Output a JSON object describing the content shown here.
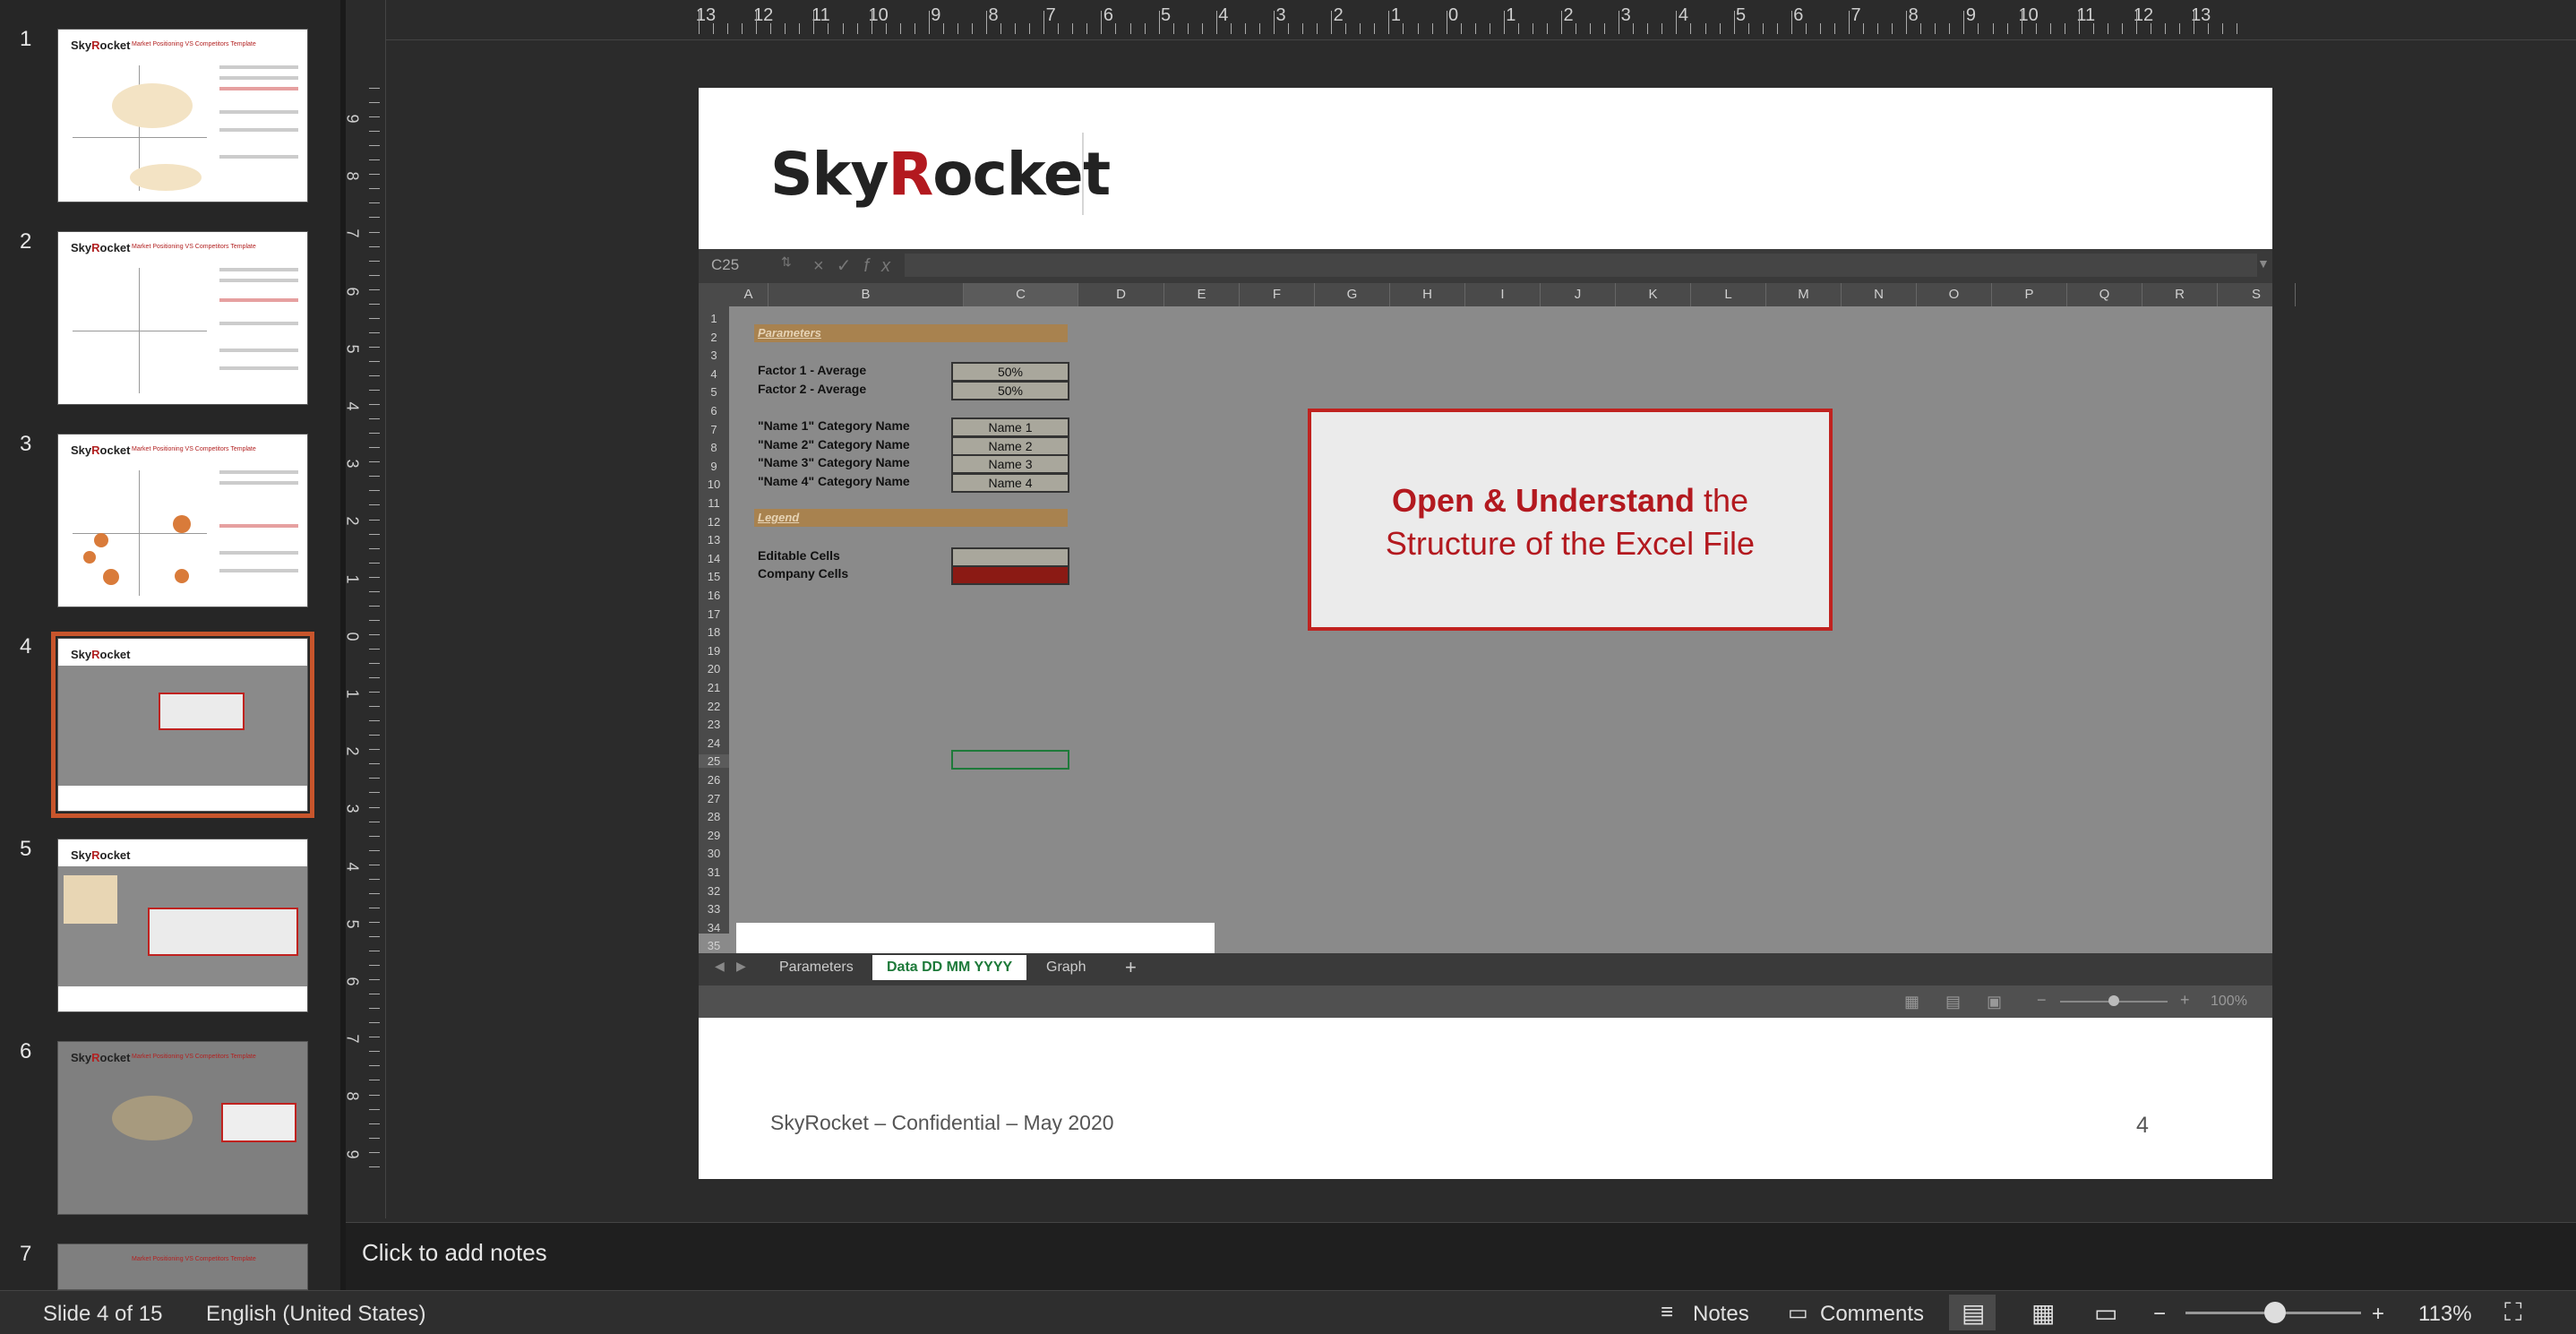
{
  "thumbnails": [
    {
      "number": "1",
      "title": "Market Positioning VS Competitors Template"
    },
    {
      "number": "2",
      "title": "Market Positioning VS Competitors Template"
    },
    {
      "number": "3",
      "title": "Market Positioning VS Competitors Template"
    },
    {
      "number": "4",
      "title": ""
    },
    {
      "number": "5",
      "title": ""
    },
    {
      "number": "6",
      "title": "Market Positioning VS Competitors Template"
    },
    {
      "number": "7",
      "title": "Market Positioning VS Competitors Template"
    }
  ],
  "thumb_logo": "Sky",
  "thumb_logo_r": "R",
  "thumb_logo_end": "ocket",
  "ruler": {
    "h": [
      "13",
      "12",
      "11",
      "10",
      "9",
      "8",
      "7",
      "6",
      "5",
      "4",
      "3",
      "2",
      "1",
      "0",
      "1",
      "2",
      "3",
      "4",
      "5",
      "6",
      "7",
      "8",
      "9",
      "10",
      "11",
      "12",
      "13"
    ],
    "v": [
      "9",
      "8",
      "7",
      "6",
      "5",
      "4",
      "3",
      "2",
      "1",
      "0",
      "1",
      "2",
      "3",
      "4",
      "5",
      "6",
      "7",
      "8",
      "9"
    ]
  },
  "slide": {
    "logo_a": "Sky",
    "logo_r": "R",
    "logo_b": "ocket",
    "footer": "SkyRocket – Confidential – May 2020",
    "page_number": "4",
    "callout_bold": "Open & Understand",
    "callout_rest": " the",
    "callout_line2": "Structure of the Excel File"
  },
  "excel": {
    "name_box": "C25",
    "fx": "fx",
    "columns": [
      "A",
      "B",
      "C",
      "D",
      "E",
      "F",
      "G",
      "H",
      "I",
      "J",
      "K",
      "L",
      "M",
      "N",
      "O",
      "P",
      "Q",
      "R",
      "S"
    ],
    "rows": [
      "1",
      "2",
      "3",
      "4",
      "5",
      "6",
      "7",
      "8",
      "9",
      "10",
      "11",
      "12",
      "13",
      "14",
      "15",
      "16",
      "17",
      "18",
      "19",
      "20",
      "21",
      "22",
      "23",
      "24",
      "25",
      "26",
      "27",
      "28",
      "29",
      "30",
      "31",
      "32",
      "33",
      "34",
      "35"
    ],
    "section_parameters": "Parameters",
    "section_legend": "Legend",
    "factor1_label": "Factor 1 - Average",
    "factor1_value": "50%",
    "factor2_label": "Factor 2 - Average",
    "factor2_value": "50%",
    "name1_label": "\"Name 1\" Category Name",
    "name1_value": "Name 1",
    "name2_label": "\"Name 2\" Category Name",
    "name2_value": "Name 2",
    "name3_label": "\"Name 3\" Category Name",
    "name3_value": "Name 3",
    "name4_label": "\"Name 4\" Category Name",
    "name4_value": "Name 4",
    "editable_label": "Editable Cells",
    "company_label": "Company Cells",
    "sheet_tabs": [
      "Parameters",
      "Data DD MM YYYY",
      "Graph"
    ],
    "add_sheet": "+",
    "zoom": "100%"
  },
  "notes_placeholder": "Click to add notes",
  "status": {
    "slide_info": "Slide 4 of 15",
    "language": "English (United States)",
    "notes": "Notes",
    "comments": "Comments",
    "zoom": "113%",
    "zoom_minus": "−",
    "zoom_plus": "+"
  },
  "colors": {
    "accent": "#c8552c",
    "brand_red": "#b3191f"
  }
}
